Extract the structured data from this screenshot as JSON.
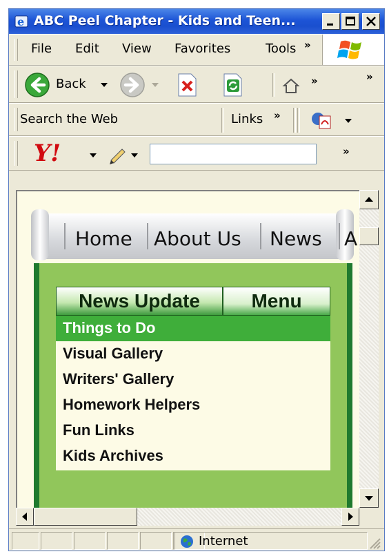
{
  "window": {
    "title": "ABC Peel Chapter - Kids and Teen..."
  },
  "menubar": {
    "items": [
      "File",
      "Edit",
      "View",
      "Favorites",
      "Tools"
    ],
    "overflow": "»"
  },
  "toolbar": {
    "back_label": "Back",
    "overflow": "»"
  },
  "searchbar": {
    "search_label": "Search the Web",
    "links_label": "Links",
    "overflow": "»"
  },
  "yahoo": {
    "logo": "Y!",
    "input_value": "",
    "overflow": "»"
  },
  "page": {
    "nav": [
      "Home",
      "About Us",
      "News",
      "A"
    ],
    "tabs": {
      "news": "News Update",
      "menu": "Menu"
    },
    "menu_items": [
      {
        "label": "Things to Do",
        "active": true
      },
      {
        "label": "Visual Gallery",
        "active": false
      },
      {
        "label": "Writers' Gallery",
        "active": false
      },
      {
        "label": "Homework Helpers",
        "active": false
      },
      {
        "label": "Fun Links",
        "active": false
      },
      {
        "label": "Kids Archives",
        "active": false
      }
    ]
  },
  "statusbar": {
    "zone": "Internet"
  },
  "colors": {
    "titlebar": "#1d54d6",
    "panel_green": "#91c65b",
    "dark_green": "#1f7a2e",
    "active_item": "#3fae3a",
    "content_bg": "#fdfbe6"
  }
}
